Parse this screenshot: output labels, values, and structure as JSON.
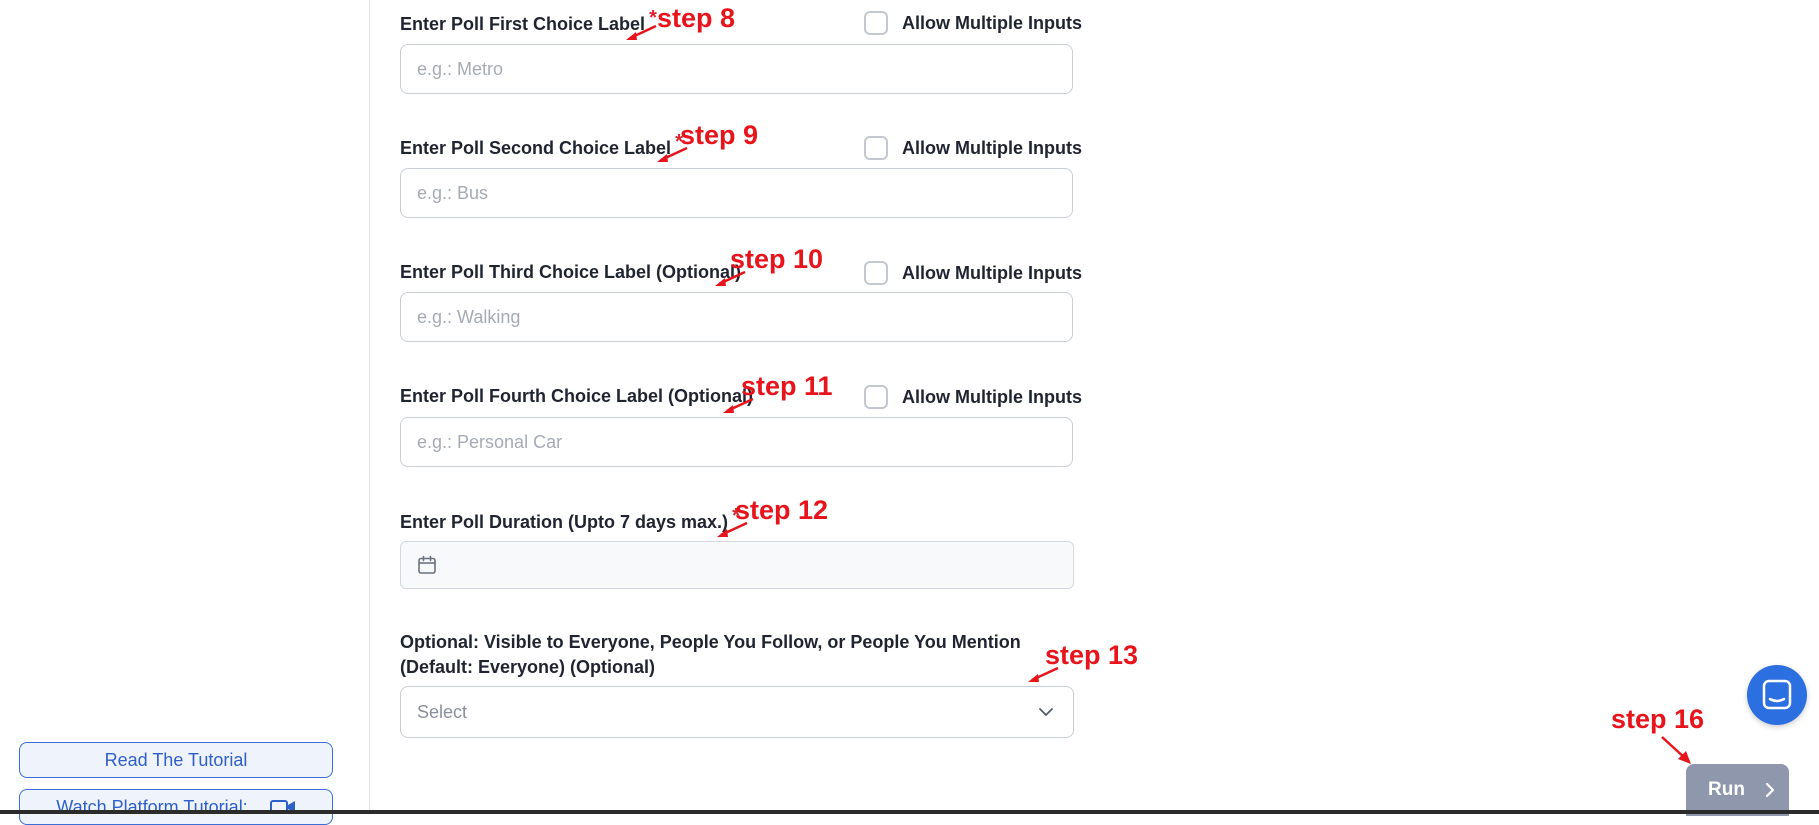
{
  "form": {
    "choice1": {
      "label": "Enter Poll First Choice Label",
      "required_mark": "*",
      "placeholder": "e.g.: Metro",
      "multi_label": "Allow Multiple Inputs"
    },
    "choice2": {
      "label": "Enter Poll Second Choice Label",
      "required_mark": "*",
      "placeholder": "e.g.: Bus",
      "multi_label": "Allow Multiple Inputs"
    },
    "choice3": {
      "label": "Enter Poll Third Choice Label (Optional)",
      "placeholder": "e.g.: Walking",
      "multi_label": "Allow Multiple Inputs"
    },
    "choice4": {
      "label": "Enter Poll Fourth Choice Label (Optional)",
      "placeholder": "e.g.: Personal Car",
      "multi_label": "Allow Multiple Inputs"
    },
    "duration": {
      "label": "Enter Poll Duration (Upto 7 days max.)",
      "required_mark": "*"
    },
    "visibility": {
      "label": "Optional: Visible to Everyone, People You Follow, or People You Mention (Default: Everyone) (Optional)",
      "selected": "Select"
    }
  },
  "annotations": {
    "step8": "step 8",
    "step9": "step 9",
    "step10": "step 10",
    "step11": "step 11",
    "step12": "step 12",
    "step13": "step 13",
    "step16": "step 16"
  },
  "sidebar": {
    "read_tutorial": "Read The Tutorial",
    "watch_tutorial": "Watch Platform Tutorial:"
  },
  "actions": {
    "run": "Run"
  },
  "colors": {
    "annotation": "#e8141c",
    "accent": "#2c6fe0",
    "run_button": "#8f97ad"
  },
  "icons": [
    "calendar-icon",
    "chevron-down-icon",
    "video-camera-icon",
    "chat-icon",
    "chevron-right-icon",
    "arrow-icon"
  ]
}
